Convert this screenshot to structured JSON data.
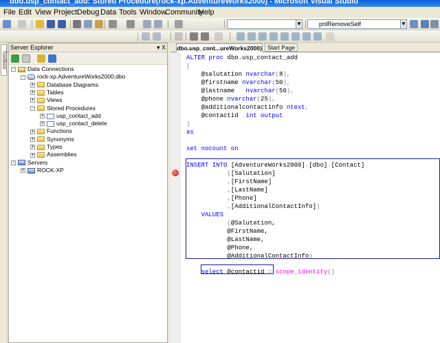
{
  "window": {
    "title": "dbo.usp_contact_add: Stored Procedure(rock-xp.AdventureWorks2000) - Microsoft Visual Studio"
  },
  "menu": [
    "File",
    "Edit",
    "View",
    "Project",
    "Debug",
    "Data",
    "Tools",
    "Window",
    "Community",
    "Help"
  ],
  "toolbar": {
    "object_combo_value": "pnlRemoveSelf"
  },
  "toolbox": {
    "label": "Toolbox"
  },
  "server_explorer": {
    "title": "Server Explorer",
    "controls": "▾ X",
    "tree": [
      {
        "label": "Data Connections",
        "level": 0,
        "icon": "conn",
        "exp": "-"
      },
      {
        "label": "rock-xp.AdventureWorks2000.dbo",
        "level": 1,
        "icon": "db",
        "exp": "-"
      },
      {
        "label": "Database Diagrams",
        "level": 2,
        "icon": "folder",
        "exp": "+"
      },
      {
        "label": "Tables",
        "level": 2,
        "icon": "folder",
        "exp": "+"
      },
      {
        "label": "Views",
        "level": 2,
        "icon": "folder",
        "exp": "+"
      },
      {
        "label": "Stored Procedures",
        "level": 2,
        "icon": "folder",
        "exp": "-"
      },
      {
        "label": "usp_contact_add",
        "level": 3,
        "icon": "proc",
        "exp": "+"
      },
      {
        "label": "usp_contact_delete",
        "level": 3,
        "icon": "proc",
        "exp": "+"
      },
      {
        "label": "Functions",
        "level": 2,
        "icon": "folder",
        "exp": "+"
      },
      {
        "label": "Synonyms",
        "level": 2,
        "icon": "folder",
        "exp": "+"
      },
      {
        "label": "Types",
        "level": 2,
        "icon": "folder",
        "exp": "+"
      },
      {
        "label": "Assemblies",
        "level": 2,
        "icon": "folder",
        "exp": "+"
      },
      {
        "label": "Servers",
        "level": 0,
        "icon": "srv",
        "exp": "-"
      },
      {
        "label": "ROCK-XP",
        "level": 1,
        "icon": "srv",
        "exp": "+"
      }
    ]
  },
  "editor": {
    "tabs": [
      {
        "label": "dbo.usp_cont...ureWorks2000)"
      },
      {
        "label": "Start Page"
      }
    ],
    "code": [
      [
        [
          "kw",
          "ALTER proc "
        ],
        [
          "",
          "dbo.usp_contact_add"
        ]
      ],
      [
        [
          "gr",
          "("
        ]
      ],
      [
        [
          "",
          "    @salutation "
        ],
        [
          "kw",
          "nvarchar"
        ],
        [
          "gr",
          "("
        ],
        [
          "",
          "8"
        ],
        [
          "gr",
          "),"
        ]
      ],
      [
        [
          "",
          "    @firstname "
        ],
        [
          "kw",
          "nvarchar"
        ],
        [
          "gr",
          "("
        ],
        [
          "",
          "50"
        ],
        [
          "gr",
          "),"
        ]
      ],
      [
        [
          "",
          "    @lastname   "
        ],
        [
          "kw",
          "nvarchar"
        ],
        [
          "gr",
          "("
        ],
        [
          "",
          "50"
        ],
        [
          "gr",
          "),"
        ]
      ],
      [
        [
          "",
          "    @phone "
        ],
        [
          "kw",
          "nvarchar"
        ],
        [
          "gr",
          "("
        ],
        [
          "",
          "25"
        ],
        [
          "gr",
          "),"
        ]
      ],
      [
        [
          "",
          "    @additionalcontactinfo "
        ],
        [
          "kw",
          "ntext"
        ],
        [
          "gr",
          ","
        ]
      ],
      [
        [
          "",
          "    @contactid  "
        ],
        [
          "kw",
          "int output"
        ]
      ],
      [
        [
          "gr",
          ")"
        ]
      ],
      [
        [
          "kw",
          "as"
        ]
      ],
      [
        [
          "",
          ""
        ]
      ],
      [
        [
          "kw",
          "set nocount on"
        ]
      ],
      [
        [
          "",
          ""
        ]
      ],
      [
        [
          "kw",
          "INSERT INTO "
        ],
        [
          "",
          "[AdventureWorks2000]"
        ],
        [
          "gr",
          "."
        ],
        [
          "",
          "[dbo]"
        ],
        [
          "gr",
          "."
        ],
        [
          "",
          "[Contact]"
        ]
      ],
      [
        [
          "",
          "           "
        ],
        [
          "gr",
          "("
        ],
        [
          "",
          "[Salutation]"
        ]
      ],
      [
        [
          "",
          "           "
        ],
        [
          "gr",
          ","
        ],
        [
          "",
          "[FirstName]"
        ]
      ],
      [
        [
          "",
          "           "
        ],
        [
          "gr",
          ","
        ],
        [
          "",
          "[LastName]"
        ]
      ],
      [
        [
          "",
          "           "
        ],
        [
          "gr",
          ","
        ],
        [
          "",
          "[Phone]"
        ]
      ],
      [
        [
          "",
          "           "
        ],
        [
          "gr",
          ","
        ],
        [
          "",
          "[AdditionalContactInfo]"
        ],
        [
          "gr",
          ")"
        ]
      ],
      [
        [
          "",
          "    "
        ],
        [
          "kw",
          "VALUES"
        ]
      ],
      [
        [
          "",
          "           "
        ],
        [
          "gr",
          "("
        ],
        [
          "",
          "@Salutation,"
        ]
      ],
      [
        [
          "",
          "           "
        ],
        [
          "",
          "@FirstName,"
        ]
      ],
      [
        [
          "",
          "           "
        ],
        [
          "",
          "@LastName,"
        ]
      ],
      [
        [
          "",
          "           "
        ],
        [
          "",
          "@Phone,"
        ]
      ],
      [
        [
          "",
          "           "
        ],
        [
          "",
          "@AdditionalContactInfo"
        ],
        [
          "gr",
          ")"
        ]
      ],
      [
        [
          "",
          ""
        ]
      ],
      [
        [
          "",
          "    "
        ],
        [
          "kw",
          "select "
        ],
        [
          "",
          "@contactid "
        ],
        [
          "gr",
          "= "
        ],
        [
          "pk",
          "scope_identity"
        ],
        [
          "gr",
          "()"
        ]
      ]
    ]
  }
}
